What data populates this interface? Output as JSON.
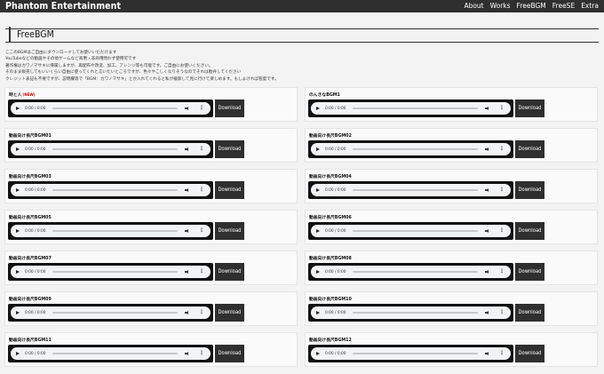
{
  "site": {
    "brand": "Phantom Entertainment",
    "nav": [
      "About",
      "Works",
      "FreeBGM",
      "FreeSE",
      "Extra"
    ]
  },
  "page": {
    "title": "FreeBGM",
    "intro": [
      "ここのBGMはご自由にダウンロードしてお使いいただけます",
      "YouTubeなどの動画やその他ゲームなど商用・非商用問わず使用可です",
      "著作権はカワノマサキに帰属しますが、再配布や改変、加工、アレンジ等も可能です。ご自由にお使いください。",
      "そのまま販売してもいいくらい自由に使ってくれと言いたいところですが、色々やこしくなりそうなのでそれは勘弁してください",
      "クレジット表記も不要ですが、説明欄等で「BGM：カワノマサキ」とか入れてくれると私が検索して見に行けて楽しめます。もしよければ程度です。"
    ]
  },
  "player": {
    "time": "0:00 / 0:00",
    "download_label": "Download"
  },
  "tracks": [
    {
      "title": "時と人",
      "badge": "(NEW)"
    },
    {
      "title": "のんきなBGM1",
      "badge": ""
    },
    {
      "title": "動画向け長尺BGM01",
      "badge": ""
    },
    {
      "title": "動画向け長尺BGM02",
      "badge": ""
    },
    {
      "title": "動画向け長尺BGM03",
      "badge": ""
    },
    {
      "title": "動画向け長尺BGM04",
      "badge": ""
    },
    {
      "title": "動画向け長尺BGM05",
      "badge": ""
    },
    {
      "title": "動画向け長尺BGM06",
      "badge": ""
    },
    {
      "title": "動画向け長尺BGM07",
      "badge": ""
    },
    {
      "title": "動画向け長尺BGM08",
      "badge": ""
    },
    {
      "title": "動画向け長尺BGM09",
      "badge": ""
    },
    {
      "title": "動画向け長尺BGM10",
      "badge": ""
    },
    {
      "title": "動画向け長尺BGM11",
      "badge": ""
    },
    {
      "title": "動画向け長尺BGM12",
      "badge": ""
    }
  ]
}
